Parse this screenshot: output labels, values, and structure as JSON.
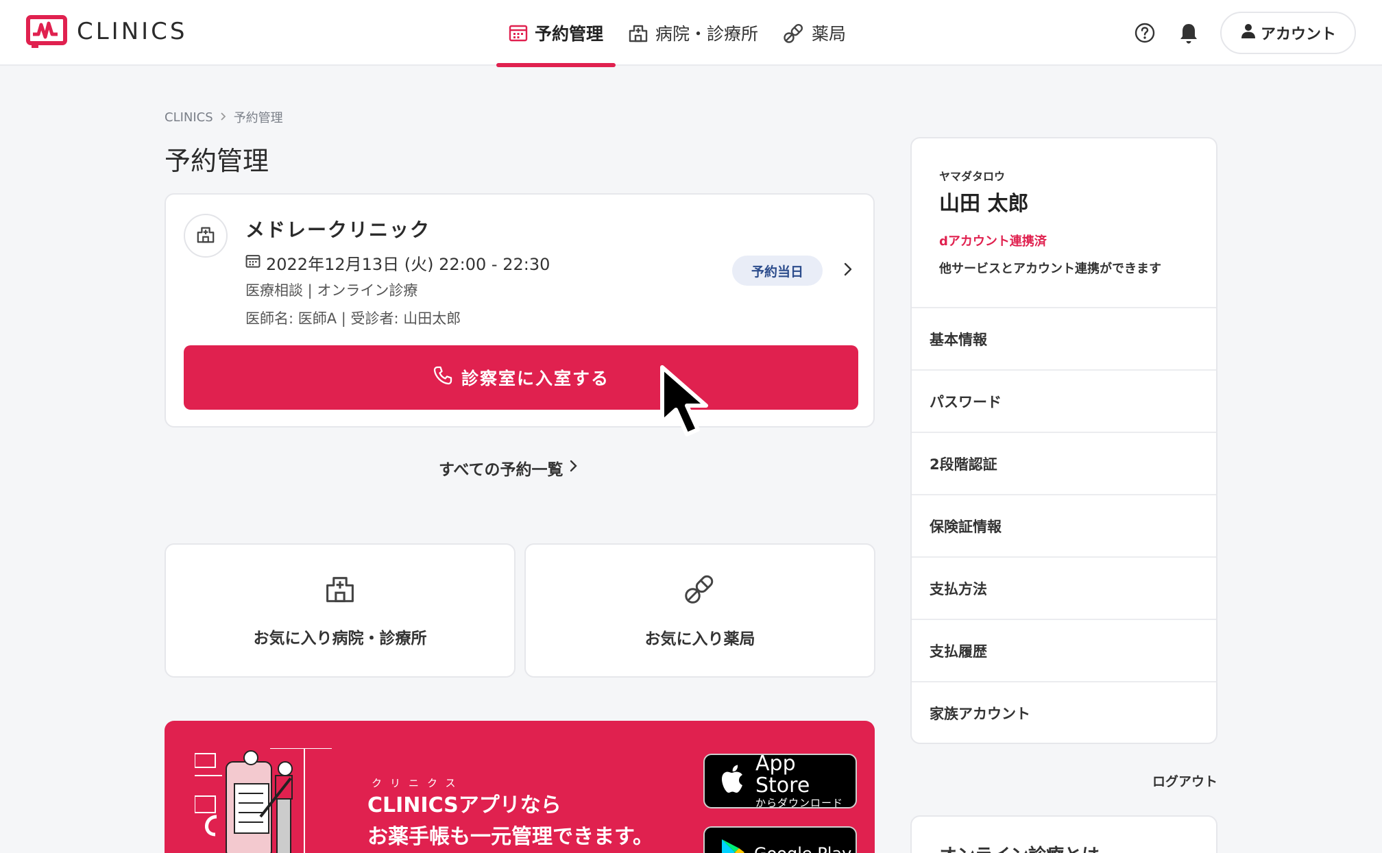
{
  "header": {
    "logo_text": "CLINICS",
    "nav": [
      {
        "label": "予約管理",
        "icon": "calendar-icon",
        "active": true
      },
      {
        "label": "病院・診療所",
        "icon": "hospital-icon",
        "active": false
      },
      {
        "label": "薬局",
        "icon": "pill-icon",
        "active": false
      }
    ],
    "account_label": "アカウント"
  },
  "breadcrumb": {
    "root": "CLINICS",
    "current": "予約管理"
  },
  "page_title": "予約管理",
  "reservation": {
    "clinic_name": "メドレークリニック",
    "datetime": "2022年12月13日 (火) 22:00 - 22:30",
    "type": "医療相談 | オンライン診療",
    "doctor": "医師名: 医師A | 受診者: 山田太郎",
    "badge": "予約当日",
    "enter_button": "診察室に入室する"
  },
  "all_reservations_link": "すべての予約一覧",
  "favorites": {
    "clinics": "お気に入り病院・診療所",
    "pharmacies": "お気に入り薬局"
  },
  "banner": {
    "ruby": "クリニクス",
    "line1": "CLINICSアプリなら",
    "line2": "お薬手帳も一元管理できます。",
    "app_store_main": "App Store",
    "app_store_sub": "からダウンロード",
    "google_play_main": "Google Play"
  },
  "sidebar": {
    "kana": "ヤマダタロウ",
    "name": "山田 太郎",
    "d_account": "dアカウント連携済",
    "d_account_desc": "他サービスとアカウント連携ができます",
    "items": [
      {
        "label": "基本情報"
      },
      {
        "label": "パスワード"
      },
      {
        "label": "2段階認証"
      },
      {
        "label": "保険証情報"
      },
      {
        "label": "支払方法"
      },
      {
        "label": "支払履歴"
      },
      {
        "label": "家族アカウント"
      }
    ],
    "logout": "ログアウト",
    "next_card_title": "オンライン診療とは"
  },
  "colors": {
    "accent": "#e0214f",
    "badge_bg": "#e9edf7",
    "badge_text": "#2c4c8c"
  }
}
